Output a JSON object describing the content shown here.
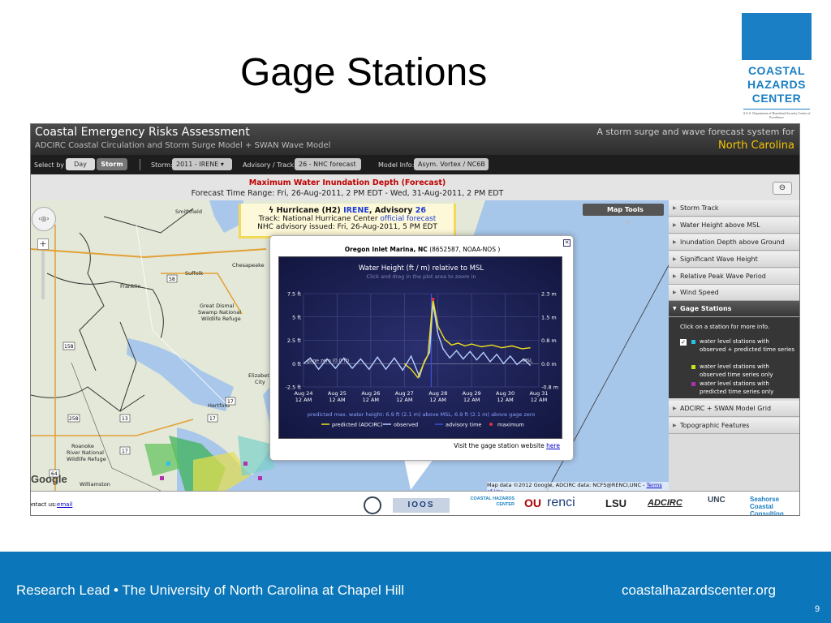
{
  "slide": {
    "title": "Gage Stations",
    "footer_left": "Research Lead  •  The University of North Carolina at Chapel Hill",
    "footer_right": "coastalhazardscenter.org",
    "page_number": "9",
    "logo": {
      "line1": "COASTAL",
      "line2": "HAZARDS",
      "line3": "CENTER",
      "tagline": "A U.S. Department of Homeland Security Center of Excellence"
    }
  },
  "app": {
    "title": "Coastal Emergency Risks Assessment",
    "subtitle": "ADCIRC Coastal Circulation and Storm Surge Model + SWAN Wave Model",
    "tagline": "A storm surge and wave forecast system for",
    "region": "North Carolina"
  },
  "toolbar": {
    "select_by_label": "Select by",
    "day_label": "Day",
    "storm_label": "Storm",
    "storm_field_label": "Storm:",
    "storm_value": "2011 - IRENE",
    "advisory_label": "Advisory / Track:",
    "advisory_value": "26 - NHC forecast",
    "model_info_label": "Model Info:",
    "model_info_value": "Asym. Vortex / NC6B"
  },
  "map_header": {
    "title": "Maximum Water Inundation Depth (Forecast)",
    "range": "Forecast Time Range:  Fri, 26-Aug-2011, 2 PM EDT  -  Wed, 31-Aug-2011, 2 PM EDT",
    "link_icon": "link-icon"
  },
  "storm_info": {
    "prefix": "Hurricane (H2)",
    "name": "IRENE",
    "advisory_text": ", Advisory",
    "advisory_number": "26",
    "track_label": "Track: National Hurricane Center",
    "track_link": "official forecast",
    "issued": "NHC advisory issued: Fri, 26-Aug-2011, 5 PM EDT"
  },
  "map": {
    "tools_label": "Map Tools",
    "copyright": "Map data ©2012 Google, ADCIRC data: NCFS@RENCI,UNC -",
    "terms": "Terms of Use",
    "google": "Google",
    "places": [
      "Smithfield",
      "Suffolk",
      "Chesapeake",
      "Franklin",
      "Great Dismal Swamp National Wildlife Refuge",
      "Elizabeth City",
      "Hertford",
      "Roanoke River National Wildlife Refuge",
      "Williamston"
    ],
    "route_shields": [
      "58",
      "17",
      "158",
      "258",
      "13",
      "17",
      "17",
      "64"
    ]
  },
  "sidebar": {
    "items": [
      {
        "label": "Storm Track"
      },
      {
        "label": "Water Height above MSL"
      },
      {
        "label": "Inundation Depth above Ground"
      },
      {
        "label": "Significant Wave Height"
      },
      {
        "label": "Relative Peak Wave Period"
      },
      {
        "label": "Wind Speed"
      },
      {
        "label": "Gage Stations"
      },
      {
        "label": "ADCIRC + SWAN Model Grid"
      },
      {
        "label": "Topographic Features"
      }
    ],
    "gage_hint": "Click on a station for more info.",
    "legend": [
      {
        "text": "water level stations with observed + predicted time series",
        "color": "#27c4e8"
      },
      {
        "text": "water level stations with observed time series only",
        "color": "#c8e020"
      },
      {
        "text": "water level stations with predicted time series only",
        "color": "#b030b0"
      }
    ]
  },
  "popup": {
    "station": "Oregon Inlet Marina, NC",
    "station_id": "(8652587, NOAA-NOS )",
    "close_icon": "close-icon",
    "link_prefix": "Visit the gage station website",
    "link_text": "here"
  },
  "bottom": {
    "contact_prefix": "ontact us:",
    "contact_link": "email",
    "partners": [
      "IOOS",
      "COASTAL HAZARDS CENTER",
      "OU",
      "renci",
      "LSU",
      "ADCIRC",
      "UNC",
      "Seahorse Coastal Consulting"
    ]
  },
  "chart_data": {
    "type": "line",
    "title": "Water Height (ft / m) relative to MSL",
    "subtitle": "Click and drag in the plot area to zoom in",
    "x_ticks": [
      "Aug 24 12 AM",
      "Aug 25 12 AM",
      "Aug 26 12 AM",
      "Aug 27 12 AM",
      "Aug 28 12 AM",
      "Aug 29 12 AM",
      "Aug 30 12 AM",
      "Aug 31 12 AM"
    ],
    "x_range": [
      "2011-08-24 00:00",
      "2011-08-31 00:00"
    ],
    "y_left_ticks": [
      "7.5 ft",
      "5 ft",
      "2.5 ft",
      "0 ft",
      "-2.5 ft"
    ],
    "y_right_ticks": [
      "2.3 m",
      "1.5 m",
      "0.8 m",
      "0.0 m",
      "-0.8 m"
    ],
    "ylim_ft": [
      -2.5,
      7.5
    ],
    "annotations": [
      "gage zero (0.0 ft)",
      "MSL"
    ],
    "caption": "predicted max. water height: 6.9 ft (2.1 m) above MSL, 6.9 ft (2.1 m) above gage zero",
    "legend": [
      "predicted (ADCIRC)",
      "observed",
      "advisory time",
      "maximum"
    ],
    "series": [
      {
        "name": "observed",
        "color": "#b8d0ff",
        "x_day": [
          0,
          0.2,
          0.45,
          0.7,
          0.95,
          1.2,
          1.45,
          1.7,
          1.95,
          2.2,
          2.45,
          2.7,
          2.95,
          3.2,
          3.45,
          3.6,
          3.75,
          3.85,
          4.0,
          4.15,
          4.35,
          4.55,
          4.75,
          4.95,
          5.15,
          5.35,
          5.55,
          5.75,
          5.95,
          6.15,
          6.35,
          6.55,
          6.75
        ],
        "y": [
          0.0,
          0.6,
          -0.6,
          0.5,
          -0.5,
          0.6,
          -0.5,
          0.5,
          -0.6,
          0.7,
          -0.6,
          0.6,
          -0.7,
          0.8,
          -1.4,
          0.3,
          1.2,
          6.4,
          3.2,
          1.6,
          0.6,
          1.4,
          0.5,
          1.3,
          0.4,
          1.2,
          0.2,
          1.0,
          0.0,
          0.8,
          -0.1,
          0.5,
          -0.2
        ]
      },
      {
        "name": "predicted (ADCIRC)",
        "color": "#f0e020",
        "x_day": [
          3.0,
          3.2,
          3.4,
          3.55,
          3.7,
          3.85,
          4.0,
          4.2,
          4.4,
          4.6,
          4.8,
          5.0,
          5.3,
          5.6,
          5.9,
          6.2,
          6.5,
          6.75
        ],
        "y": [
          0.0,
          -0.6,
          -1.5,
          -0.2,
          0.9,
          6.9,
          4.0,
          2.6,
          2.0,
          2.2,
          1.9,
          2.1,
          1.8,
          2.0,
          1.7,
          1.9,
          1.6,
          1.7
        ]
      }
    ],
    "advisory_time_day": 3.8,
    "max_point": {
      "x_day": 3.85,
      "y": 6.9
    }
  }
}
